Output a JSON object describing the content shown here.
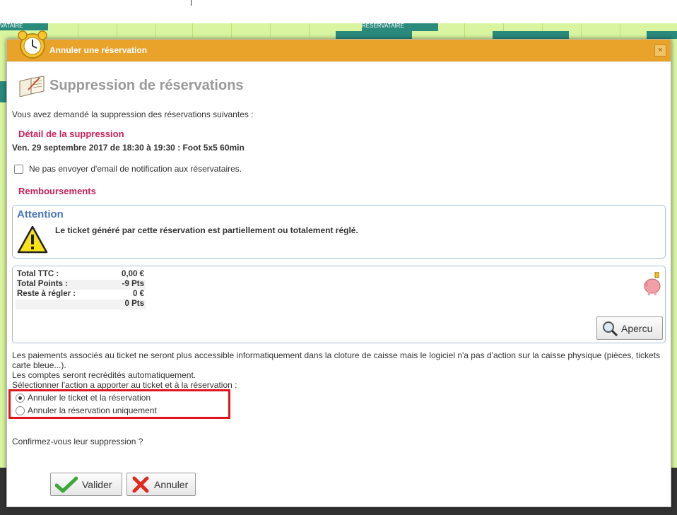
{
  "background": {
    "event_labels": [
      "RESERVATAIRE",
      "RESERVATAIRE",
      "VATAIRE"
    ]
  },
  "dialog": {
    "title": "Annuler une réservation",
    "close_glyph": "×",
    "heading": "Suppression de réservations",
    "intro": "Vous avez demandé la suppression des réservations suivantes :",
    "detail_title": "Détail de la suppression",
    "detail_line": "Ven. 29 septembre 2017 de 18:30 à 19:30 : Foot 5x5 60min",
    "no_email_label": "Ne pas envoyer d'email de notification aux réservataires.",
    "refunds_title": "Remboursements",
    "attention": {
      "title": "Attention",
      "message": "Le ticket généré par cette réservation est partiellement ou totalement réglé."
    },
    "totals": [
      {
        "label": "Total TTC :",
        "value": "0,00 €"
      },
      {
        "label": "Total Points :",
        "value": "-9 Pts"
      },
      {
        "label": "Reste à régler :",
        "value": "0 €"
      },
      {
        "label": "",
        "value": "0 Pts"
      }
    ],
    "apercu_label": "Apercu",
    "payments_text": "Les paiements associés au ticket ne seront plus accessible informatiquement dans la cloture de caisse mais le logiciel n'a pas d'action sur la caisse physique (pièces, tickets carte bleue...).",
    "accounts_text": "Les comptes seront recrédités automatiquement.",
    "select_action_text": "Sélectionner l'action a apporter au ticket et à la réservation :",
    "options": [
      {
        "label": "Annuler le ticket et la réservation",
        "selected": true
      },
      {
        "label": "Annuler la réservation uniquement",
        "selected": false
      }
    ],
    "confirm_text": "Confirmez-vous leur suppression ?",
    "validate_label": "Valider",
    "cancel_label": "Annuler"
  },
  "colors": {
    "titlebar": "#e9a22a",
    "section_title": "#cc1f5a",
    "attention_title": "#4a78b8",
    "highlight_box": "#e0141e"
  }
}
